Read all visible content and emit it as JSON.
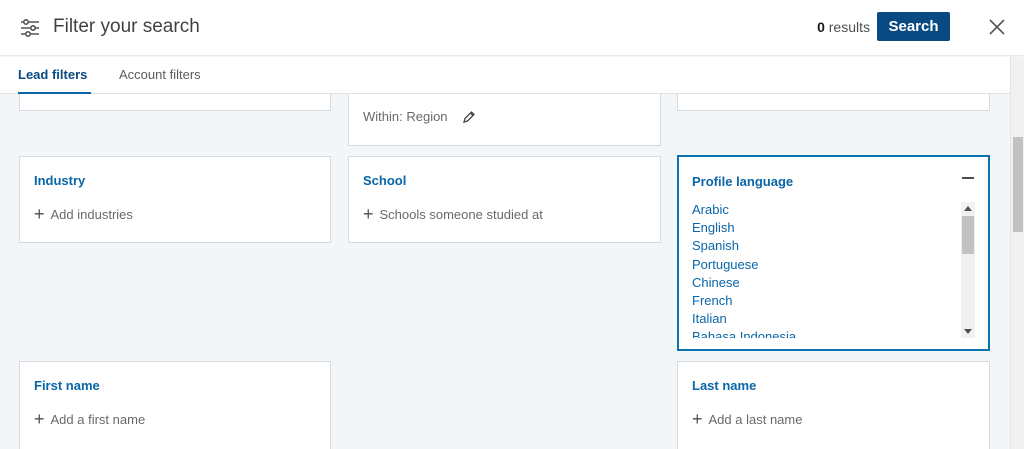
{
  "header": {
    "title": "Filter your search",
    "results_count": "0",
    "results_label": "results",
    "search_label": "Search",
    "icons": {
      "filter": "sliders-icon",
      "close": "close-icon"
    }
  },
  "tabs": [
    {
      "label": "Lead filters",
      "active": true
    },
    {
      "label": "Account filters",
      "active": false
    }
  ],
  "filters": {
    "geography": {
      "region_label": "Within: Region"
    },
    "industry": {
      "label": "Industry",
      "add_text": "Add industries"
    },
    "school": {
      "label": "School",
      "add_text": "Schools someone studied at"
    },
    "profile_language": {
      "label": "Profile language",
      "options": [
        "Arabic",
        "English",
        "Spanish",
        "Portuguese",
        "Chinese",
        "French",
        "Italian",
        "Bahasa Indonesia"
      ]
    },
    "first_name": {
      "label": "First name",
      "add_text": "Add a first name"
    },
    "last_name": {
      "label": "Last name",
      "add_text": "Add a last name"
    }
  },
  "colors": {
    "accent": "#0a66a8",
    "button": "#0a4a82",
    "background": "#f3f6f8"
  }
}
